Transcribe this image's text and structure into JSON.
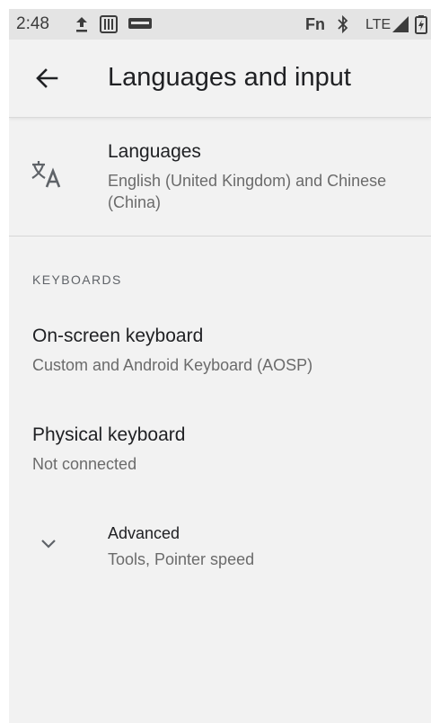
{
  "status_bar": {
    "time": "2:48",
    "fn_label": "Fn",
    "network_label": "LTE",
    "icons": [
      "upload-icon",
      "sim-icon",
      "volte-icon",
      "bluetooth-icon",
      "signal-icon",
      "battery-charging-icon"
    ]
  },
  "app_bar": {
    "title": "Languages and input"
  },
  "languages": {
    "title": "Languages",
    "summary": "English (United Kingdom) and Chinese (China)"
  },
  "keyboards": {
    "header": "KEYBOARDS",
    "on_screen": {
      "title": "On-screen keyboard",
      "summary": "Custom and Android Keyboard (AOSP)"
    },
    "physical": {
      "title": "Physical keyboard",
      "summary": "Not connected"
    }
  },
  "advanced": {
    "title": "Advanced",
    "summary": "Tools, Pointer speed"
  },
  "colors": {
    "background": "#f2f2f2",
    "status_bar": "#e4e4e4",
    "primary_text": "#202124",
    "secondary_text": "#6b6b6b"
  }
}
